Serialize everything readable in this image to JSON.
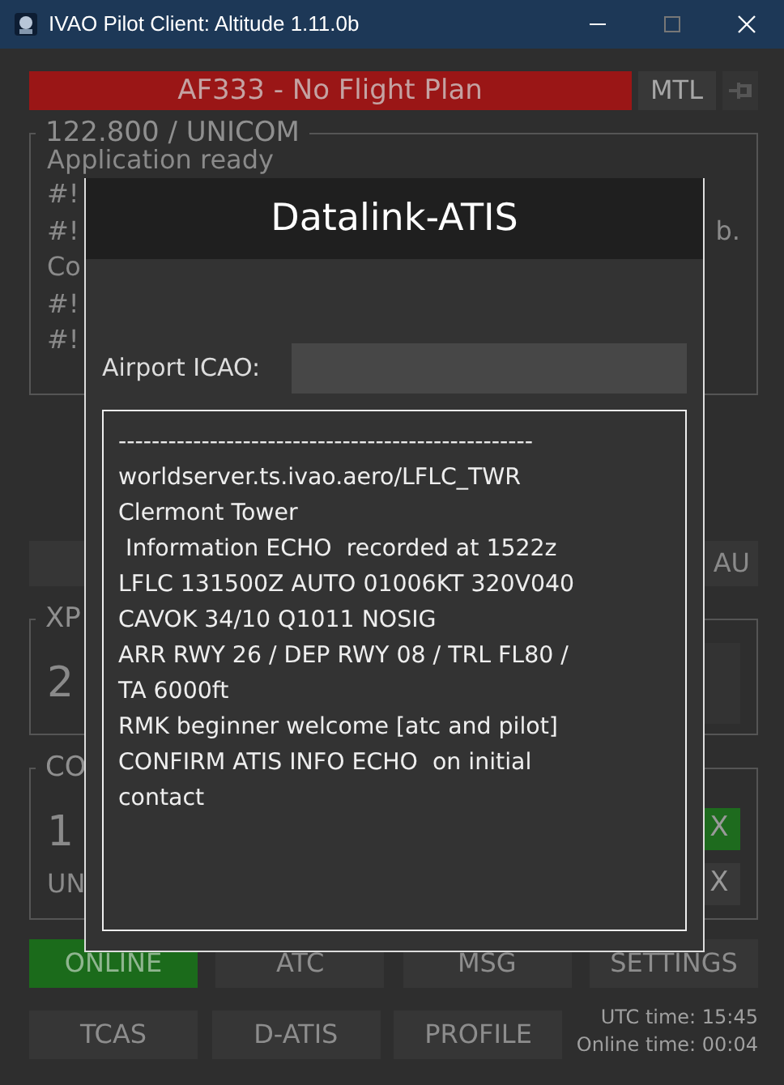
{
  "window": {
    "title": "IVAO Pilot Client: Altitude 1.11.0b"
  },
  "callsign_bar": {
    "text": "AF333 - No Flight Plan",
    "has_flight_plan": false
  },
  "mtl_button": "MTL",
  "comm_panel": {
    "legend": "122.800 / UNICOM",
    "log_lines": [
      {
        "left": "Application ready"
      },
      {
        "left": "#!"
      },
      {
        "left": "#!",
        "right": "b."
      },
      {
        "left": "Co"
      },
      {
        "left": "#!"
      },
      {
        "left": "#!"
      }
    ]
  },
  "au_button": "AU",
  "xpdr_panel": {
    "legend": "XP",
    "value": "2"
  },
  "com_panel": {
    "legend": "CO",
    "value": "1",
    "sub": "UN",
    "buttons": [
      {
        "label": "X",
        "active": true
      },
      {
        "label": "X",
        "active": false
      }
    ]
  },
  "dialog": {
    "title": "Datalink-ATIS",
    "airport_label": "Airport ICAO:",
    "atis_lines": [
      "--------------------------------------------------",
      "worldserver.ts.ivao.aero/LFLC_TWR",
      "Clermont Tower",
      " Information ECHO  recorded at 1522z",
      "LFLC 131500Z AUTO 01006KT 320V040",
      "CAVOK 34/10 Q1011 NOSIG",
      "ARR RWY 26 / DEP RWY 08 / TRL FL80 /",
      "TA 6000ft",
      "RMK beginner welcome [atc and pilot]",
      "CONFIRM ATIS INFO ECHO  on initial",
      "contact"
    ]
  },
  "nav_buttons": [
    {
      "label": "ONLINE",
      "active": true
    },
    {
      "label": "ATC",
      "active": false
    },
    {
      "label": "MSG",
      "active": false
    },
    {
      "label": "SETTINGS",
      "active": false
    },
    {
      "label": "TCAS",
      "active": false
    },
    {
      "label": "D-ATIS",
      "active": false
    },
    {
      "label": "PROFILE",
      "active": false
    }
  ],
  "status": {
    "utc": "UTC time: 15:45",
    "online": "Online time: 00:04"
  }
}
